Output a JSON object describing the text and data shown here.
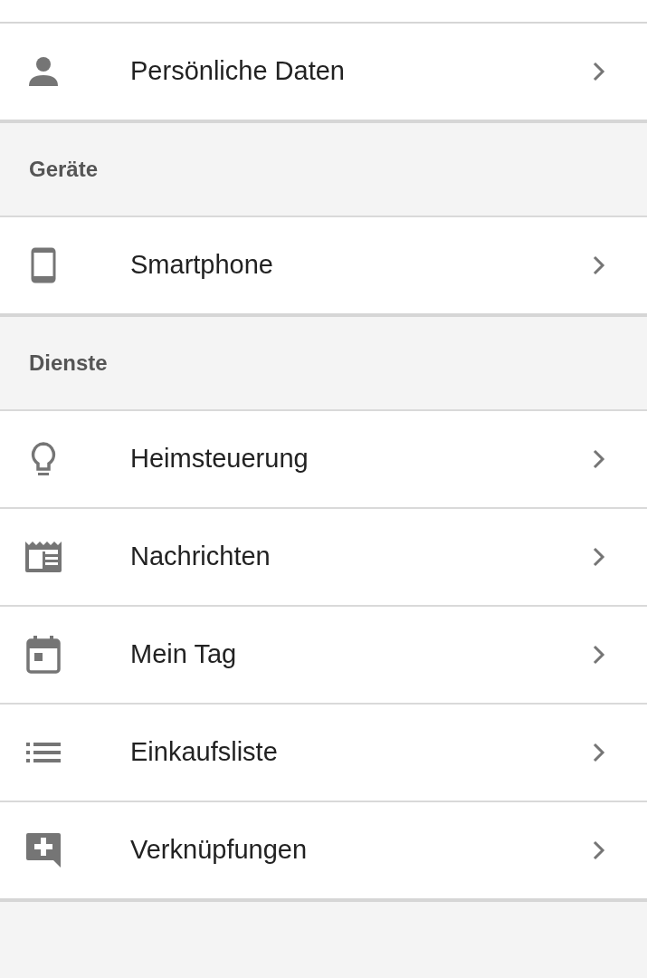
{
  "sections": [
    {
      "items": [
        {
          "label": "Persönliche Daten"
        }
      ]
    },
    {
      "title": "Geräte",
      "items": [
        {
          "label": "Smartphone"
        }
      ]
    },
    {
      "title": "Dienste",
      "items": [
        {
          "label": "Heimsteuerung"
        },
        {
          "label": "Nachrichten"
        },
        {
          "label": "Mein Tag"
        },
        {
          "label": "Einkaufsliste"
        },
        {
          "label": "Verknüpfungen"
        }
      ]
    }
  ]
}
